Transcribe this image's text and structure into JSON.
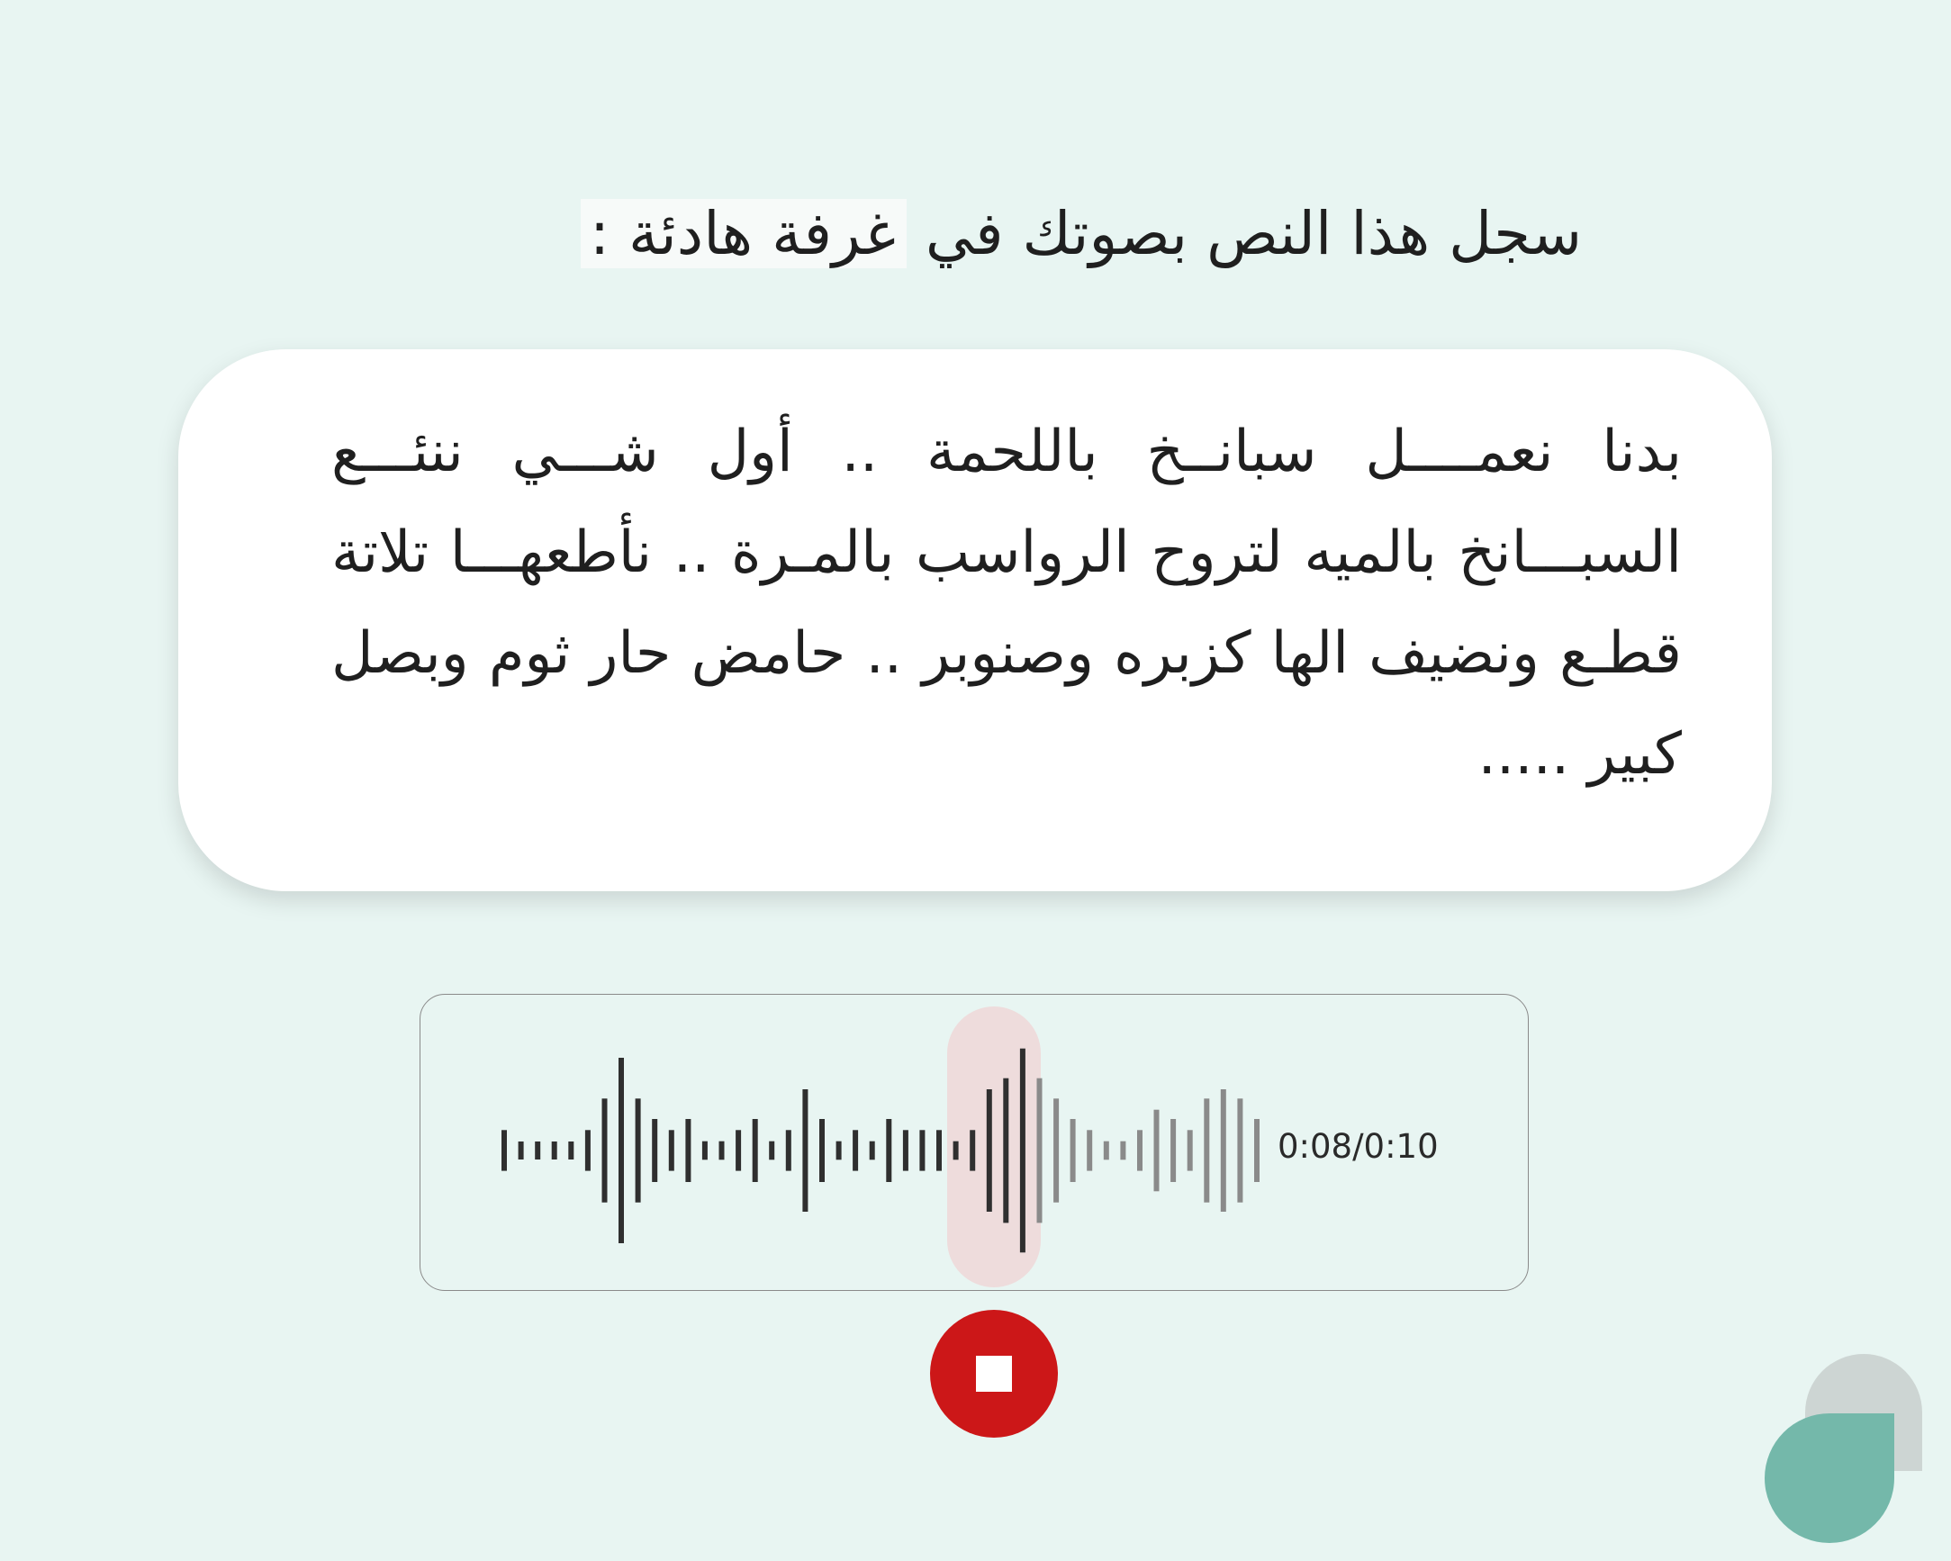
{
  "instruction": {
    "before": "سجل هذا النص بصوتك في ",
    "highlighted": "غرفة هادئة :"
  },
  "passage": "بدنا نعمــــل سبانــخ باللحمة .. أول شـــي ننئـــع السبـــانخ بالميه لتروح الرواسب بالمـرة .. نأطعهـــا تلاتة قطـع ونضيف الها كزبره وصنوبر .. حامض حار ثوم وبصل كبير .....",
  "player": {
    "time": "0:08/0:10",
    "played_color": "#2f2f2f",
    "remaining_color": "#8a8a8a",
    "bar_amplitudes": [
      0.22,
      0.08,
      0.08,
      0.08,
      0.08,
      0.22,
      0.56,
      1.0,
      0.56,
      0.34,
      0.22,
      0.34,
      0.1,
      0.1,
      0.22,
      0.34,
      0.1,
      0.22,
      0.66,
      0.34,
      0.1,
      0.22,
      0.1,
      0.34,
      0.22,
      0.22,
      0.22,
      0.1,
      0.22,
      0.66,
      0.78,
      1.1,
      0.78,
      0.56,
      0.34,
      0.22,
      0.1,
      0.1,
      0.22,
      0.44,
      0.34,
      0.22,
      0.56,
      0.66,
      0.56,
      0.34
    ]
  },
  "stop_button": {
    "label": "stop",
    "color": "#cc1718"
  },
  "progress_fraction": 0.8
}
